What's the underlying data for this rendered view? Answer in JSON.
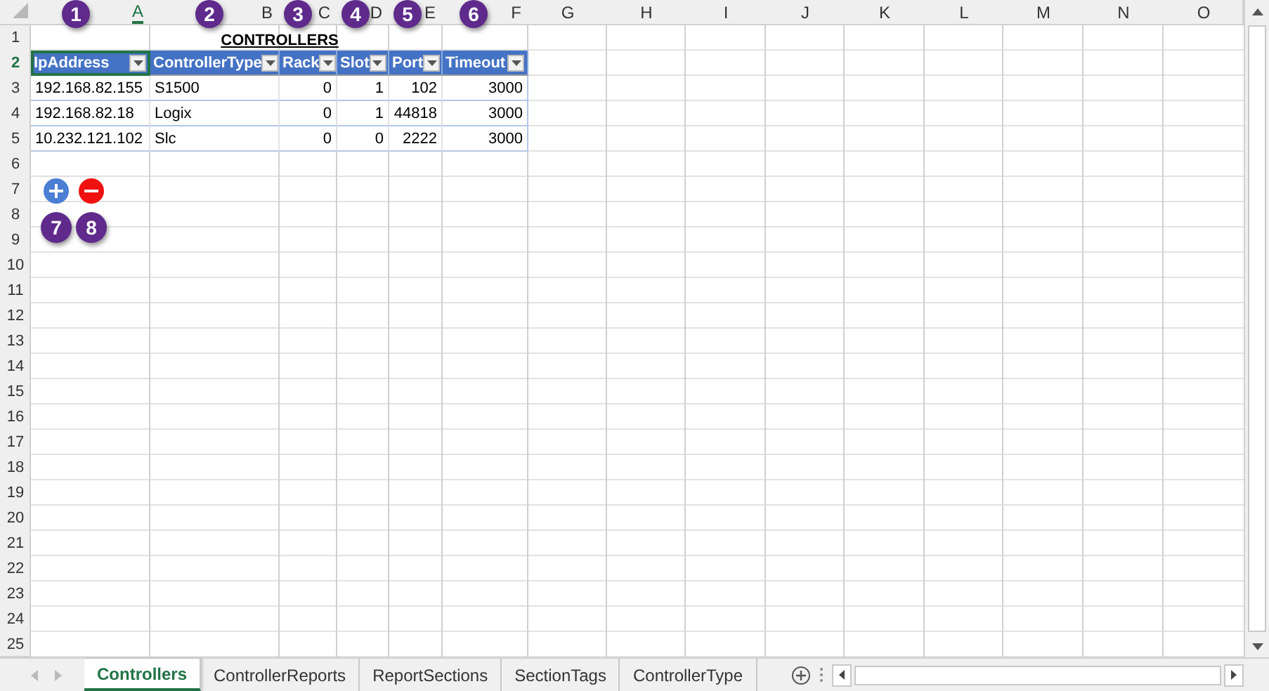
{
  "sheet": {
    "column_letters": [
      "A",
      "B",
      "C",
      "D",
      "E",
      "F",
      "G",
      "H",
      "I",
      "J",
      "K",
      "L",
      "M",
      "N",
      "O"
    ],
    "row_numbers": [
      "1",
      "2",
      "3",
      "4",
      "5",
      "6",
      "7",
      "8",
      "9",
      "10",
      "11",
      "12",
      "13",
      "14",
      "15",
      "16",
      "17",
      "18",
      "19",
      "20",
      "21",
      "22",
      "23",
      "24",
      "25"
    ],
    "title": "CONTROLLERS",
    "table": {
      "columns": [
        {
          "label": "IpAddress",
          "numeric": false,
          "selected": true
        },
        {
          "label": "ControllerType",
          "numeric": false,
          "selected": false
        },
        {
          "label": "Rack",
          "numeric": true,
          "selected": false
        },
        {
          "label": "Slot",
          "numeric": true,
          "selected": false
        },
        {
          "label": "Port",
          "numeric": true,
          "selected": false
        },
        {
          "label": "Timeout",
          "numeric": true,
          "selected": false
        }
      ],
      "rows": [
        [
          "192.168.82.155",
          "S1500",
          "0",
          "1",
          "102",
          "3000"
        ],
        [
          "192.168.82.18",
          "Logix",
          "0",
          "1",
          "44818",
          "3000"
        ],
        [
          "10.232.121.102",
          "Slc",
          "0",
          "0",
          "2222",
          "3000"
        ]
      ]
    },
    "column_callouts": [
      "1",
      "2",
      "3",
      "4",
      "5",
      "6"
    ],
    "buttons": [
      {
        "kind": "add",
        "callout": "7"
      },
      {
        "kind": "remove",
        "callout": "8"
      }
    ]
  },
  "sheet_tabs": [
    {
      "label": "Controllers",
      "selected": true
    },
    {
      "label": "ControllerReports",
      "selected": false
    },
    {
      "label": "ReportSections",
      "selected": false
    },
    {
      "label": "SectionTags",
      "selected": false
    },
    {
      "label": "ControllerType",
      "selected": false
    }
  ]
}
